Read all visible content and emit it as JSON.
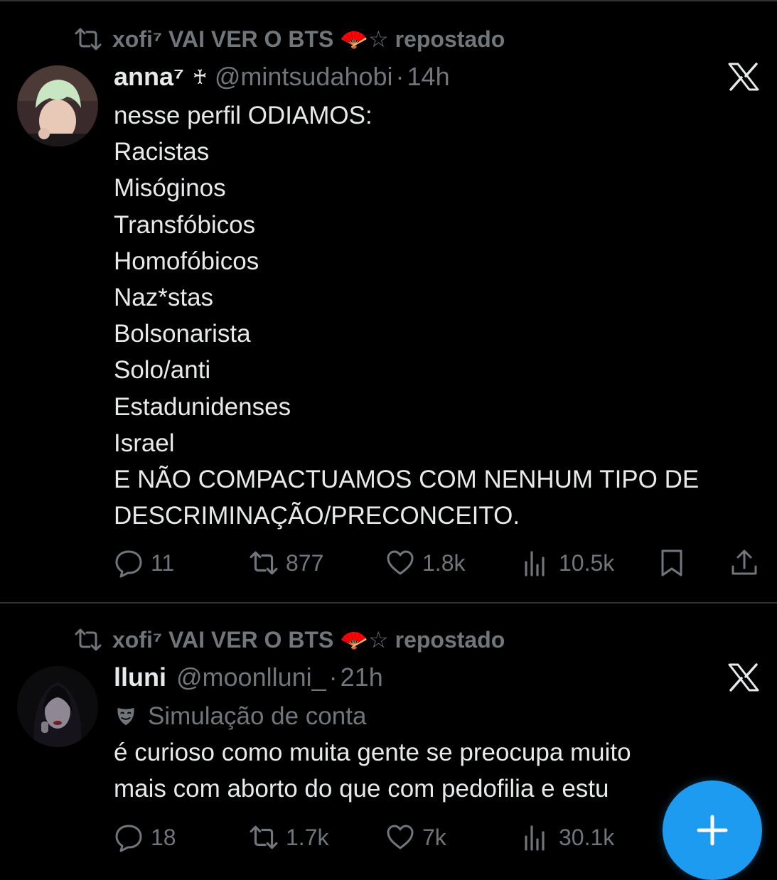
{
  "tweets": [
    {
      "repost": {
        "text": "xofi⁷ VAI VER O BTS 🪭☆ repostado"
      },
      "author": {
        "name": "anna⁷",
        "badge": "♰",
        "handle": "@mintsudahobi",
        "separator": "·",
        "time": "14h"
      },
      "body": "nesse perfil ODIAMOS:\nRacistas\nMisóginos\nTransfóbicos\nHomofóbicos\nNaz*stas\nBolsonarista\nSolo/anti\nEstadunidenses\nIsrael\nE NÃO COMPACTUAMOS COM NENHUM TIPO DE\nDESCRIMINAÇÃO/PRECONCEITO.",
      "stats": {
        "replies": "11",
        "reposts": "877",
        "likes": "1.8k",
        "views": "10.5k"
      }
    },
    {
      "repost": {
        "text": "xofi⁷ VAI VER O BTS 🪭☆ repostado"
      },
      "author": {
        "name": "lluni",
        "handle": "@moonlluni_",
        "separator": "·",
        "time": "21h"
      },
      "label": "Simulação de conta",
      "body": "é curioso como muita gente se preocupa muito\nmais com aborto do que com pedofilia e estu",
      "stats": {
        "replies": "18",
        "reposts": "1.7k",
        "likes": "7k",
        "views": "30.1k"
      }
    }
  ],
  "icons": {
    "repost": "repost-icon",
    "x_logo": "x-logo-icon",
    "reply": "reply-icon",
    "like": "heart-icon",
    "views": "views-icon",
    "bookmark": "bookmark-icon",
    "share": "share-icon",
    "mask": "theater-mask-icon",
    "compose": "plus-icon"
  },
  "colors": {
    "background": "#000000",
    "text": "#e7e9ea",
    "muted": "#71767b",
    "accent": "#1d9bf0",
    "divider": "#2f3336"
  }
}
